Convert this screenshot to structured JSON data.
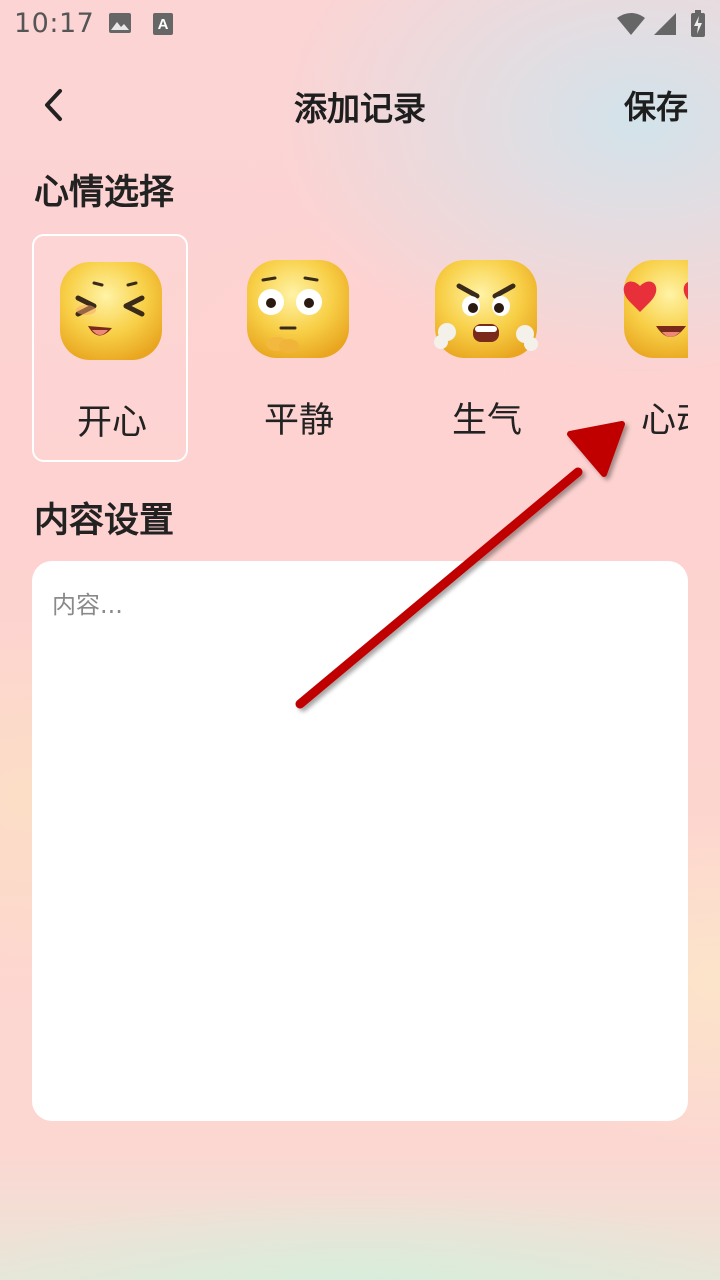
{
  "status_bar": {
    "time": "10:17",
    "icons": [
      "image-icon",
      "a-notification-icon",
      "wifi-icon",
      "cellular-icon",
      "battery-charging-icon"
    ]
  },
  "header": {
    "title": "添加记录",
    "save_label": "保存",
    "back_icon": "chevron-left-icon"
  },
  "mood_section": {
    "title": "心情选择",
    "selected": "开心",
    "items": [
      {
        "label": "开心",
        "icon": "happy-face-icon"
      },
      {
        "label": "平静",
        "icon": "calm-face-icon"
      },
      {
        "label": "生气",
        "icon": "angry-face-icon"
      },
      {
        "label": "心动",
        "icon": "heart-eyes-face-icon"
      }
    ]
  },
  "content_section": {
    "title": "内容设置",
    "placeholder": "内容...",
    "value": ""
  },
  "colors": {
    "accent_arrow": "#c00000",
    "face_yellow": "#f7c83a",
    "card_bg": "#ffffff"
  }
}
